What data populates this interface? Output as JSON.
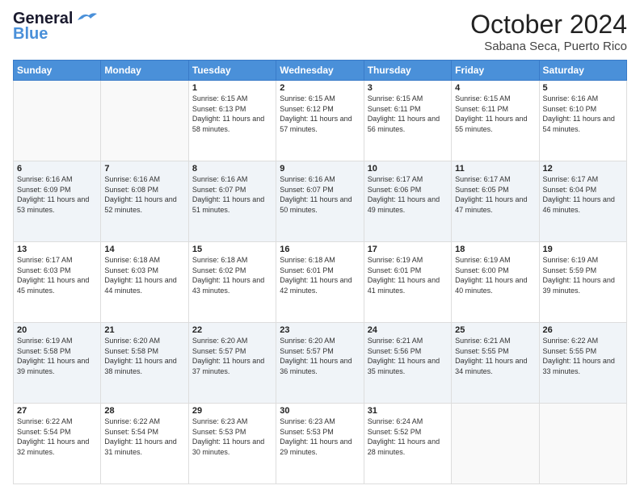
{
  "header": {
    "logo_line1": "General",
    "logo_line2": "Blue",
    "title": "October 2024",
    "subtitle": "Sabana Seca, Puerto Rico"
  },
  "weekdays": [
    "Sunday",
    "Monday",
    "Tuesday",
    "Wednesday",
    "Thursday",
    "Friday",
    "Saturday"
  ],
  "days": [
    {
      "num": "",
      "info": ""
    },
    {
      "num": "",
      "info": ""
    },
    {
      "num": "1",
      "info": "Sunrise: 6:15 AM\nSunset: 6:13 PM\nDaylight: 11 hours and 58 minutes."
    },
    {
      "num": "2",
      "info": "Sunrise: 6:15 AM\nSunset: 6:12 PM\nDaylight: 11 hours and 57 minutes."
    },
    {
      "num": "3",
      "info": "Sunrise: 6:15 AM\nSunset: 6:11 PM\nDaylight: 11 hours and 56 minutes."
    },
    {
      "num": "4",
      "info": "Sunrise: 6:15 AM\nSunset: 6:11 PM\nDaylight: 11 hours and 55 minutes."
    },
    {
      "num": "5",
      "info": "Sunrise: 6:16 AM\nSunset: 6:10 PM\nDaylight: 11 hours and 54 minutes."
    },
    {
      "num": "6",
      "info": "Sunrise: 6:16 AM\nSunset: 6:09 PM\nDaylight: 11 hours and 53 minutes."
    },
    {
      "num": "7",
      "info": "Sunrise: 6:16 AM\nSunset: 6:08 PM\nDaylight: 11 hours and 52 minutes."
    },
    {
      "num": "8",
      "info": "Sunrise: 6:16 AM\nSunset: 6:07 PM\nDaylight: 11 hours and 51 minutes."
    },
    {
      "num": "9",
      "info": "Sunrise: 6:16 AM\nSunset: 6:07 PM\nDaylight: 11 hours and 50 minutes."
    },
    {
      "num": "10",
      "info": "Sunrise: 6:17 AM\nSunset: 6:06 PM\nDaylight: 11 hours and 49 minutes."
    },
    {
      "num": "11",
      "info": "Sunrise: 6:17 AM\nSunset: 6:05 PM\nDaylight: 11 hours and 47 minutes."
    },
    {
      "num": "12",
      "info": "Sunrise: 6:17 AM\nSunset: 6:04 PM\nDaylight: 11 hours and 46 minutes."
    },
    {
      "num": "13",
      "info": "Sunrise: 6:17 AM\nSunset: 6:03 PM\nDaylight: 11 hours and 45 minutes."
    },
    {
      "num": "14",
      "info": "Sunrise: 6:18 AM\nSunset: 6:03 PM\nDaylight: 11 hours and 44 minutes."
    },
    {
      "num": "15",
      "info": "Sunrise: 6:18 AM\nSunset: 6:02 PM\nDaylight: 11 hours and 43 minutes."
    },
    {
      "num": "16",
      "info": "Sunrise: 6:18 AM\nSunset: 6:01 PM\nDaylight: 11 hours and 42 minutes."
    },
    {
      "num": "17",
      "info": "Sunrise: 6:19 AM\nSunset: 6:01 PM\nDaylight: 11 hours and 41 minutes."
    },
    {
      "num": "18",
      "info": "Sunrise: 6:19 AM\nSunset: 6:00 PM\nDaylight: 11 hours and 40 minutes."
    },
    {
      "num": "19",
      "info": "Sunrise: 6:19 AM\nSunset: 5:59 PM\nDaylight: 11 hours and 39 minutes."
    },
    {
      "num": "20",
      "info": "Sunrise: 6:19 AM\nSunset: 5:58 PM\nDaylight: 11 hours and 39 minutes."
    },
    {
      "num": "21",
      "info": "Sunrise: 6:20 AM\nSunset: 5:58 PM\nDaylight: 11 hours and 38 minutes."
    },
    {
      "num": "22",
      "info": "Sunrise: 6:20 AM\nSunset: 5:57 PM\nDaylight: 11 hours and 37 minutes."
    },
    {
      "num": "23",
      "info": "Sunrise: 6:20 AM\nSunset: 5:57 PM\nDaylight: 11 hours and 36 minutes."
    },
    {
      "num": "24",
      "info": "Sunrise: 6:21 AM\nSunset: 5:56 PM\nDaylight: 11 hours and 35 minutes."
    },
    {
      "num": "25",
      "info": "Sunrise: 6:21 AM\nSunset: 5:55 PM\nDaylight: 11 hours and 34 minutes."
    },
    {
      "num": "26",
      "info": "Sunrise: 6:22 AM\nSunset: 5:55 PM\nDaylight: 11 hours and 33 minutes."
    },
    {
      "num": "27",
      "info": "Sunrise: 6:22 AM\nSunset: 5:54 PM\nDaylight: 11 hours and 32 minutes."
    },
    {
      "num": "28",
      "info": "Sunrise: 6:22 AM\nSunset: 5:54 PM\nDaylight: 11 hours and 31 minutes."
    },
    {
      "num": "29",
      "info": "Sunrise: 6:23 AM\nSunset: 5:53 PM\nDaylight: 11 hours and 30 minutes."
    },
    {
      "num": "30",
      "info": "Sunrise: 6:23 AM\nSunset: 5:53 PM\nDaylight: 11 hours and 29 minutes."
    },
    {
      "num": "31",
      "info": "Sunrise: 6:24 AM\nSunset: 5:52 PM\nDaylight: 11 hours and 28 minutes."
    },
    {
      "num": "",
      "info": ""
    },
    {
      "num": "",
      "info": ""
    }
  ]
}
